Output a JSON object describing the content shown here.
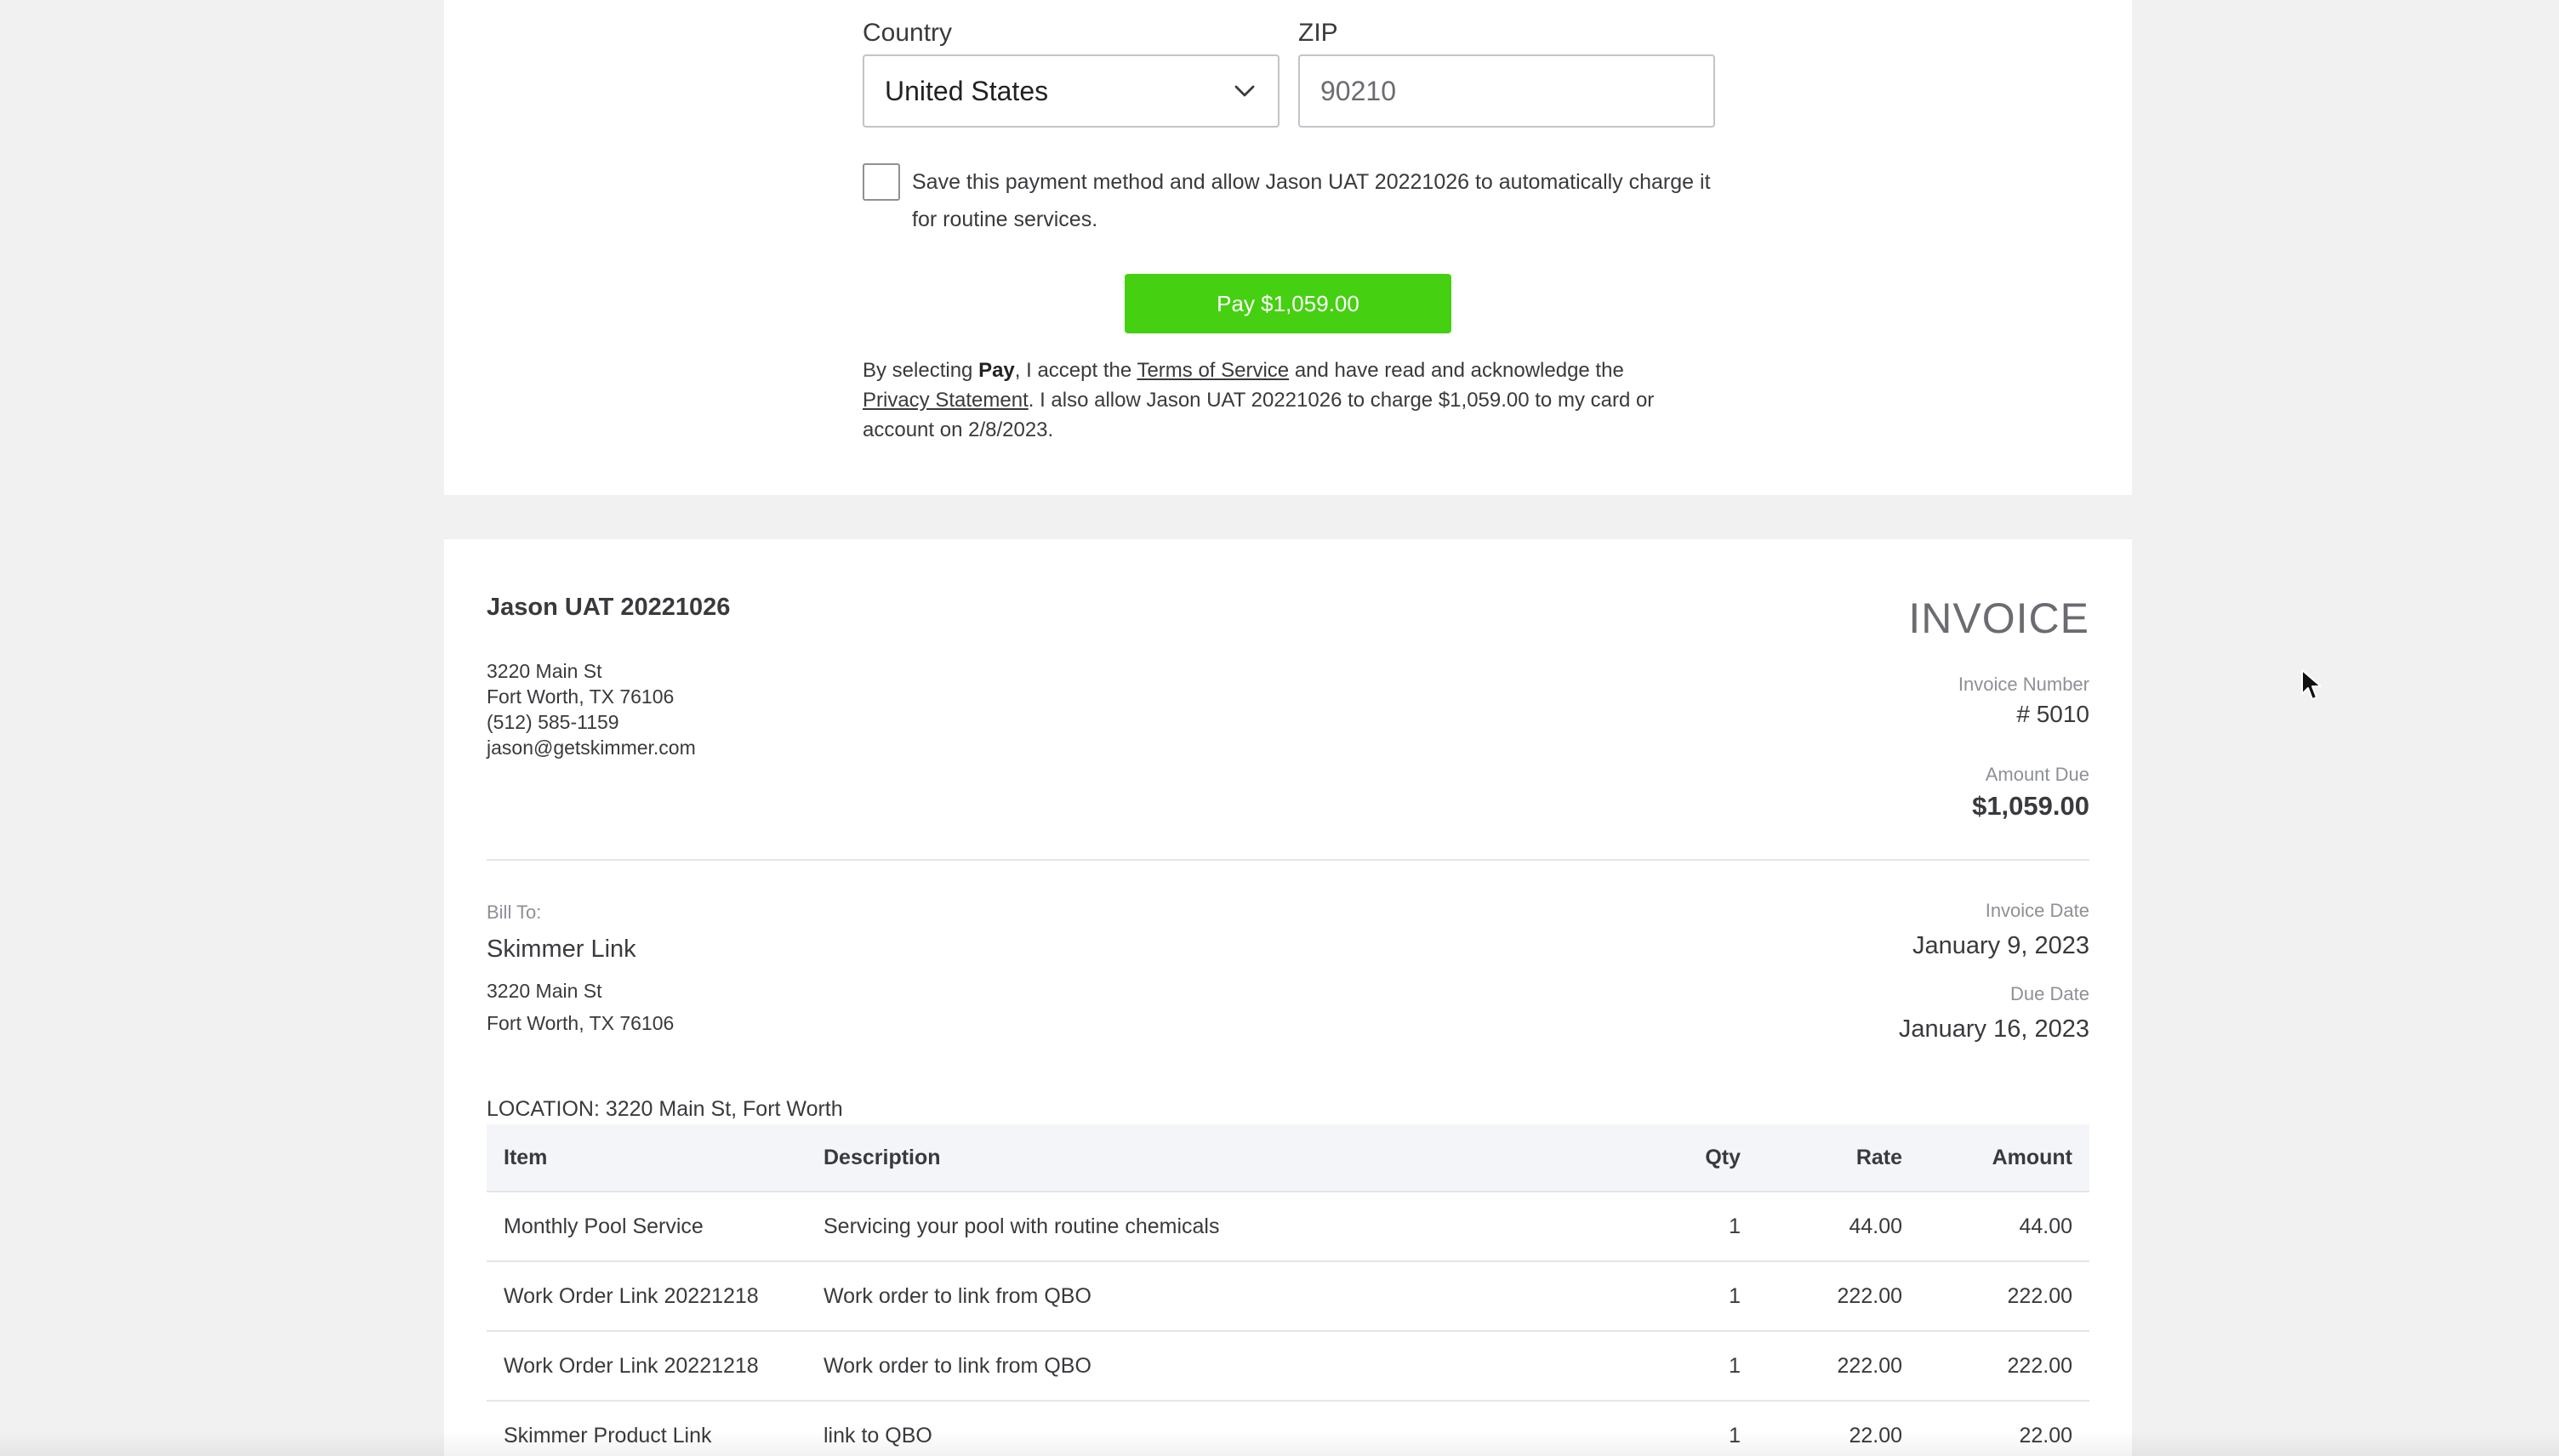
{
  "payment_form": {
    "country_label": "Country",
    "country_value": "United States",
    "zip_label": "ZIP",
    "zip_value": "90210",
    "save_method_text": "Save this payment method and allow Jason UAT 20221026 to automatically charge it for routine services.",
    "pay_button": "Pay $1,059.00",
    "legal": {
      "p1": "By selecting ",
      "pay_word": "Pay",
      "p2": ", I accept the ",
      "terms_link": "Terms of Service",
      "p3": " and have read and acknowledge the ",
      "privacy_link": "Privacy Statement",
      "p4": ". I also allow Jason UAT 20221026 to charge $1,059.00 to my card or account on 2/8/2023."
    }
  },
  "invoice": {
    "company": {
      "name": "Jason UAT 20221026",
      "address1": "3220 Main St",
      "address2": "Fort Worth, TX 76106",
      "phone": "(512) 585-1159",
      "email": "jason@getskimmer.com"
    },
    "title": "INVOICE",
    "invoice_number_label": "Invoice Number",
    "invoice_number": "# 5010",
    "amount_due_label": "Amount Due",
    "amount_due": "$1,059.00",
    "bill_to": {
      "label": "Bill To:",
      "name": "Skimmer Link",
      "address1": "3220 Main St",
      "address2": "Fort Worth, TX 76106"
    },
    "invoice_date_label": "Invoice Date",
    "invoice_date": "January 9, 2023",
    "due_date_label": "Due Date",
    "due_date": "January 16, 2023",
    "location": "LOCATION: 3220 Main St, Fort Worth",
    "table": {
      "headers": [
        "Item",
        "Description",
        "Qty",
        "Rate",
        "Amount"
      ],
      "rows": [
        [
          "Monthly Pool Service",
          "Servicing your pool with routine chemicals",
          "1",
          "44.00",
          "44.00"
        ],
        [
          "Work Order Link 20221218",
          "Work order to link from QBO",
          "1",
          "222.00",
          "222.00"
        ],
        [
          "Work Order Link 20221218",
          "Work order to link from QBO",
          "1",
          "222.00",
          "222.00"
        ],
        [
          "Skimmer Product Link",
          "link to QBO",
          "1",
          "22.00",
          "22.00"
        ]
      ]
    }
  },
  "colors": {
    "pay_button": "#46d012",
    "page_background": "#f1f1f1"
  },
  "icons": {
    "select_chevron": "chevron-down-icon",
    "mouse_cursor": "cursor-arrow-icon"
  }
}
